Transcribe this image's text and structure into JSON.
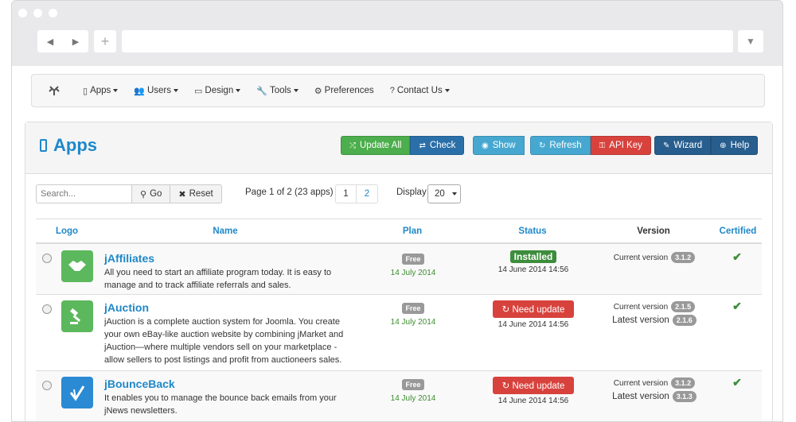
{
  "browser": {
    "back_icon": "back-arrow-icon",
    "forward_icon": "forward-arrow-icon",
    "new_tab_glyph": "+",
    "menu_glyph": "▼"
  },
  "navbar": {
    "items": [
      {
        "label": "Apps",
        "icon": "phone-icon"
      },
      {
        "label": "Users",
        "icon": "users-icon"
      },
      {
        "label": "Design",
        "icon": "monitor-icon"
      },
      {
        "label": "Tools",
        "icon": "wrench-icon"
      },
      {
        "label": "Preferences",
        "icon": "gears-icon"
      },
      {
        "label": "Contact Us",
        "icon": "question-icon"
      }
    ]
  },
  "panel": {
    "title": "Apps",
    "buttons": {
      "update_all": "Update All",
      "check": "Check",
      "show": "Show",
      "refresh": "Refresh",
      "api_key": "API Key",
      "wizard": "Wizard",
      "help": "Help"
    }
  },
  "filter": {
    "search_placeholder": "Search...",
    "go": "Go",
    "reset": "Reset",
    "page_info": "Page 1 of 2 (23 apps)",
    "pages": [
      "1",
      "2"
    ],
    "display_label": "Display",
    "display_value": "20"
  },
  "table": {
    "headers": {
      "logo": "Logo",
      "name": "Name",
      "plan": "Plan",
      "status": "Status",
      "version": "Version",
      "certified": "Certified"
    },
    "rows": [
      {
        "name": "jAffiliates",
        "desc": "All you need to start an affiliate program today. It is easy to manage and to track affiliate referrals and sales.",
        "plan": "Free",
        "plan_date": "14 July 2014",
        "status": "Installed",
        "status_date": "14 June 2014 14:56",
        "current_label": "Current version",
        "current_version": "3.1.2",
        "latest_label": "",
        "latest_version": "",
        "certified": "✔"
      },
      {
        "name": "jAuction",
        "desc": "jAuction is a complete auction system for Joomla. You create your own eBay-like auction website by combining jMarket and jAuction—where multiple vendors sell on your marketplace - allow sellers to post listings and profit from auctioneers sales.",
        "plan": "Free",
        "plan_date": "14 July 2014",
        "status": "Need update",
        "status_date": "14 June 2014 14:56",
        "current_label": "Current version",
        "current_version": "2.1.5",
        "latest_label": "Latest version",
        "latest_version": "2.1.6",
        "certified": "✔"
      },
      {
        "name": "jBounceBack",
        "desc": "It enables you to manage the bounce back emails from your jNews newsletters.",
        "plan": "Free",
        "plan_date": "14 July 2014",
        "status": "Need update",
        "status_date": "14 June 2014 14:56",
        "current_label": "Current version",
        "current_version": "3.1.2",
        "latest_label": "Latest version",
        "latest_version": "3.1.3",
        "certified": "✔"
      }
    ]
  },
  "colors": {
    "accent": "#1e88c9",
    "green": "#4cae4c",
    "red": "#d8423d",
    "logo_green": "#5cb85c",
    "logo_blue": "#2a8ad4"
  }
}
